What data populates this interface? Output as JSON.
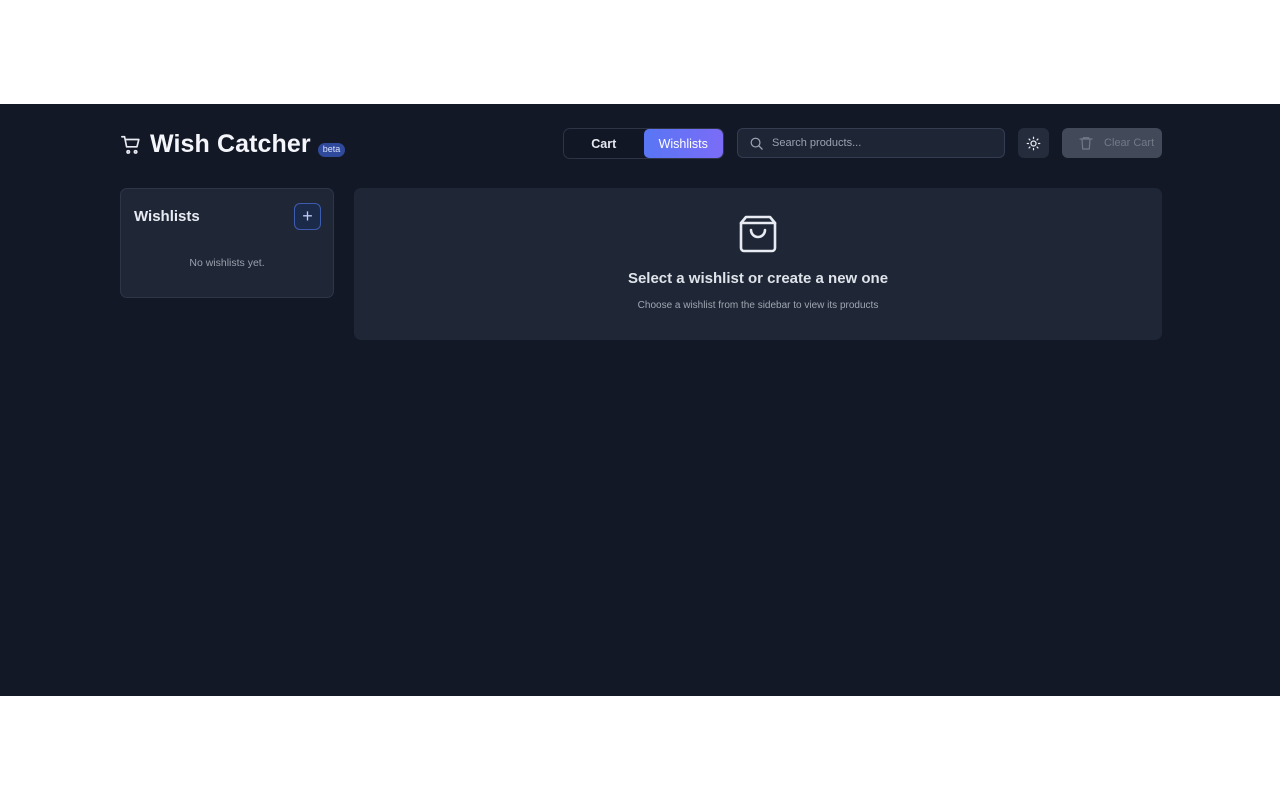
{
  "app": {
    "title": "Wish Catcher",
    "badge": "beta"
  },
  "nav": {
    "tabs": [
      {
        "label": "Cart",
        "active": false
      },
      {
        "label": "Wishlists",
        "active": true
      }
    ]
  },
  "search": {
    "placeholder": "Search products...",
    "value": ""
  },
  "toolbar": {
    "theme_icon": "sun-icon",
    "clear_label": "Clear Cart",
    "clear_disabled": true
  },
  "sidebar": {
    "title": "Wishlists",
    "add_icon": "plus-icon",
    "empty_text": "No wishlists yet."
  },
  "main": {
    "icon": "shopping-bag-icon",
    "heading": "Select a wishlist or create a new one",
    "subtext": "Choose a wishlist from the sidebar to view its products"
  },
  "colors": {
    "background": "#131826",
    "panel": "#1f2636",
    "accent_start": "#5876f5",
    "accent_end": "#7b6cf6"
  }
}
